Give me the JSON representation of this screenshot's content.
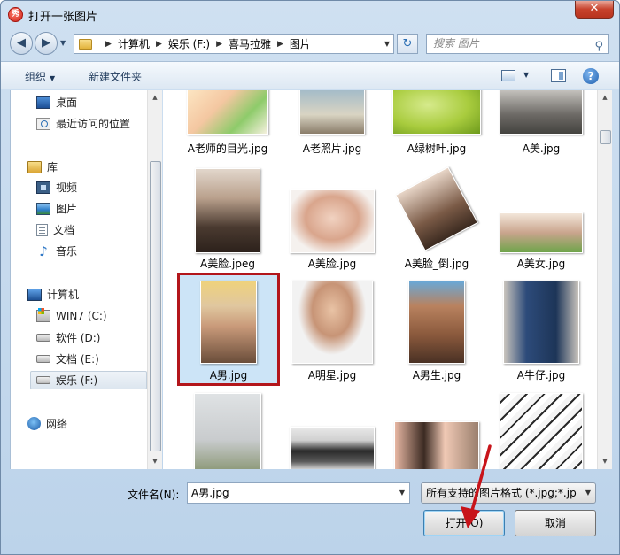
{
  "window": {
    "title": "打开一张图片",
    "app_icon_glyph": "秀",
    "close_glyph": "✕"
  },
  "address": {
    "crumbs": [
      "计算机",
      "娱乐 (F:)",
      "喜马拉雅",
      "图片"
    ],
    "search_placeholder": "搜索 图片"
  },
  "toolbar": {
    "organize": "组织",
    "new_folder": "新建文件夹",
    "help_glyph": "?"
  },
  "nav": {
    "items": [
      {
        "label": "桌面",
        "icon": "desktop-icon"
      },
      {
        "label": "最近访问的位置",
        "icon": "recent-places-icon"
      },
      {
        "label": "库",
        "icon": "library-icon"
      },
      {
        "label": "视频",
        "icon": "video-icon"
      },
      {
        "label": "图片",
        "icon": "pictures-icon"
      },
      {
        "label": "文档",
        "icon": "documents-icon"
      },
      {
        "label": "音乐",
        "icon": "music-icon"
      },
      {
        "label": "计算机",
        "icon": "computer-icon"
      },
      {
        "label": "WIN7 (C:)",
        "icon": "system-drive-icon"
      },
      {
        "label": "软件 (D:)",
        "icon": "drive-icon"
      },
      {
        "label": "文档 (E:)",
        "icon": "drive-icon"
      },
      {
        "label": "娱乐 (F:)",
        "icon": "drive-icon",
        "selected": true
      },
      {
        "label": "网络",
        "icon": "network-icon"
      }
    ]
  },
  "files": [
    {
      "name": "A老师的目光.jpg"
    },
    {
      "name": "A老照片.jpg"
    },
    {
      "name": "A绿树叶.jpg"
    },
    {
      "name": "A美.jpg"
    },
    {
      "name": "A美脸.jpeg"
    },
    {
      "name": "A美脸.jpg"
    },
    {
      "name": "A美脸_倒.jpg"
    },
    {
      "name": "A美女.jpg"
    },
    {
      "name": "A男.jpg",
      "selected": true
    },
    {
      "name": "A明星.jpg"
    },
    {
      "name": "A男生.jpg"
    },
    {
      "name": "A牛仔.jpg"
    },
    {
      "name": ""
    },
    {
      "name": ""
    },
    {
      "name": ""
    },
    {
      "name": ""
    }
  ],
  "footer": {
    "filename_label": "文件名(N):",
    "filename_value": "A男.jpg",
    "filetype_value": "所有支持的图片格式 (*.jpg;*.jp",
    "open_button": "打开(O)",
    "cancel_button": "取消"
  },
  "colors": {
    "selection_highlight": "#b3161b",
    "annotation_arrow": "#c8141a"
  }
}
